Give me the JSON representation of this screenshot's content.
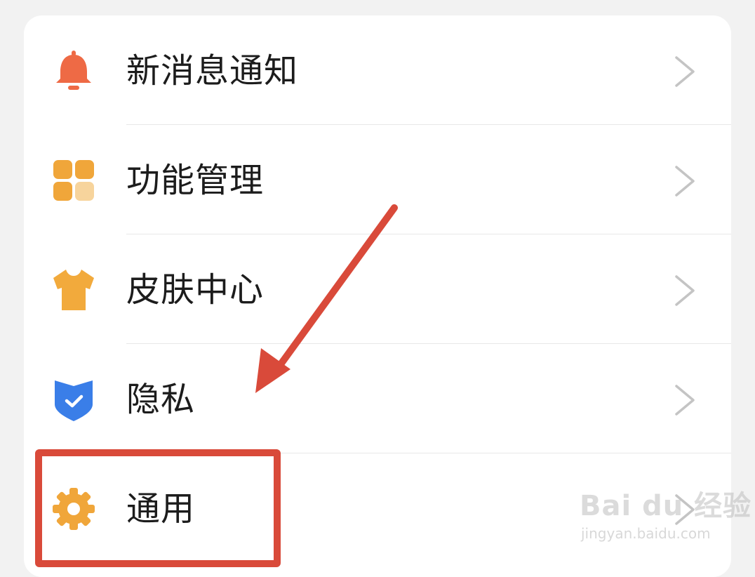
{
  "colors": {
    "background": "#f2f2f2",
    "card": "#ffffff",
    "text": "#1c1c1c",
    "chevron": "#c4c4c4",
    "divider": "#e8e8e8",
    "bell": "#ee6a45",
    "grid": "#f0a63a",
    "grid_light": "#f7d49c",
    "shirt": "#f2aa3c",
    "shield": "#3a7ee8",
    "gear": "#f0a63a",
    "annotation": "#d94a3a"
  },
  "settings": {
    "items": [
      {
        "label": "新消息通知",
        "icon": "bell-icon"
      },
      {
        "label": "功能管理",
        "icon": "grid-icon"
      },
      {
        "label": "皮肤中心",
        "icon": "shirt-icon"
      },
      {
        "label": "隐私",
        "icon": "shield-check-icon"
      },
      {
        "label": "通用",
        "icon": "gear-icon"
      }
    ]
  },
  "watermark": {
    "brand": "Bai du 经验",
    "url": "jingyan.baidu.com"
  }
}
